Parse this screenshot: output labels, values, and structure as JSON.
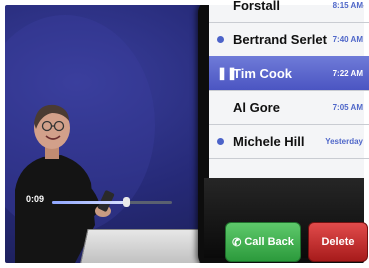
{
  "voicemail": {
    "items": [
      {
        "name": "Forstall",
        "time": "8:15 AM",
        "state": "read"
      },
      {
        "name": "Bertrand Serlet",
        "time": "7:40 AM",
        "state": "unread"
      },
      {
        "name": "Tim Cook",
        "time": "7:22 AM",
        "state": "playing"
      },
      {
        "name": "Al Gore",
        "time": "7:05 AM",
        "state": "read"
      },
      {
        "name": "Michele Hill",
        "time": "Yesterday",
        "state": "unread"
      }
    ],
    "playback": {
      "elapsed": "0:09",
      "progress": 0.62
    },
    "buttons": {
      "call_back": "Call Back",
      "delete": "Delete"
    },
    "colors": {
      "accent": "#4f67c9",
      "call_back": "#36a845",
      "delete": "#c62828"
    },
    "icons": {
      "call_back": "phone-icon",
      "playing": "pause-icon",
      "unread": "unread-dot-icon"
    }
  }
}
